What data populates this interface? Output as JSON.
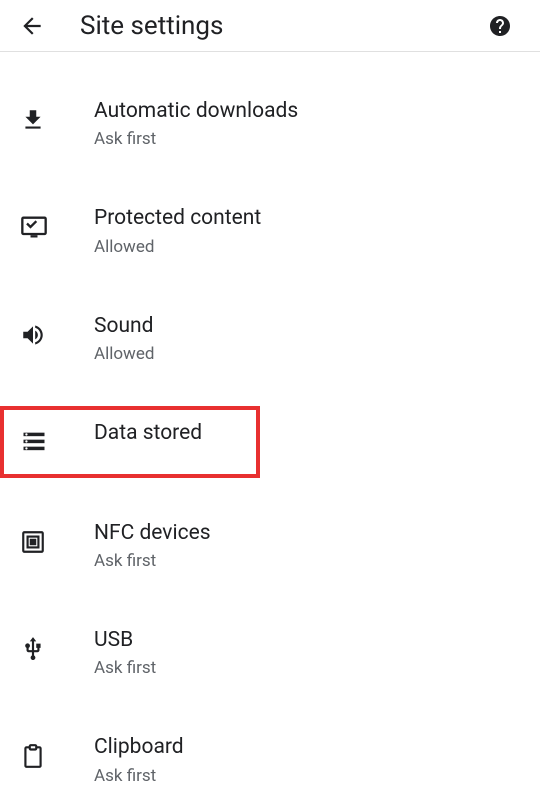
{
  "header": {
    "title": "Site settings"
  },
  "items": [
    {
      "title": "Automatic downloads",
      "subtitle": "Ask first",
      "icon": "download"
    },
    {
      "title": "Protected content",
      "subtitle": "Allowed",
      "icon": "protected"
    },
    {
      "title": "Sound",
      "subtitle": "Allowed",
      "icon": "sound"
    },
    {
      "title": "Data stored",
      "subtitle": "",
      "icon": "data",
      "highlighted": true
    },
    {
      "title": "NFC devices",
      "subtitle": "Ask first",
      "icon": "nfc"
    },
    {
      "title": "USB",
      "subtitle": "Ask first",
      "icon": "usb"
    },
    {
      "title": "Clipboard",
      "subtitle": "Ask first",
      "icon": "clipboard"
    }
  ]
}
